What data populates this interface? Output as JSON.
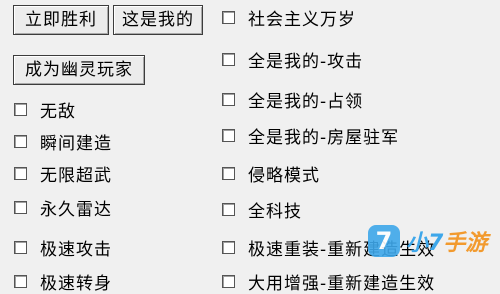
{
  "buttons": {
    "win": "立即胜利",
    "mine": "这是我的",
    "ghost": "成为幽灵玩家"
  },
  "left_options": [
    "无敌",
    "瞬间建造",
    "无限超武",
    "永久雷达",
    "极速攻击",
    "极速转身"
  ],
  "right_options": [
    "社会主义万岁",
    "全是我的-攻击",
    "全是我的-占领",
    "全是我的-房屋驻军",
    "侵略模式",
    "全科技",
    "极速重装-重新建造生效",
    "大用增强-重新建造生效"
  ],
  "watermark": {
    "mark": "7",
    "text_a": "小7",
    "text_b": "手游"
  }
}
